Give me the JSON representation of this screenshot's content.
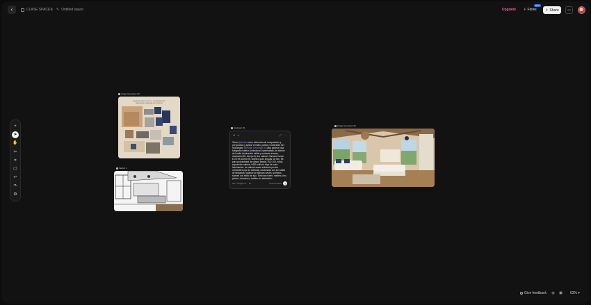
{
  "topbar": {
    "spaces_label": "CLASE SPACES",
    "separator": ">",
    "space_name": "Untitled space",
    "upgrade_label": "Upgrade",
    "flows_label": "Flows",
    "flows_badge": "New",
    "share_label": "Share"
  },
  "toolbar": {
    "tools": [
      "plus-icon",
      "cursor-icon",
      "hand-icon",
      "scissors-icon",
      "crop-icon",
      "comment-icon",
      "undo-icon",
      "redo-icon",
      "settings-icon"
    ]
  },
  "nodes": {
    "moodboard_label": "Image Generator #2",
    "moodboard_heading": "REFERENCIAS DE ESTILO Y ELABORACIÓN MATERIALES PARA SALÓN INTERIOR",
    "sketch_label": "Sketch 1",
    "assistant_label": "Assistant #1",
    "livingroom_label": "Image Generator #1"
  },
  "assistant": {
    "prompt_parts": [
      {
        "text": "Toma ",
        "mention": false
      },
      {
        "text": "@sketch",
        "mention": true
      },
      {
        "text": " como referencia de composición y perspectiva y aplicar el estilo, paleta y materiales del moodboard ",
        "mention": false
      },
      {
        "text": "@Image Generator #2",
        "mention": true
      },
      {
        "text": " para generar una fotografía interior profesional, hiperrealista, de interior de bonita iluminación cálida y sombras suaves, resolución 8K, tiempo de luz natural. Cámara Canon EOS R5 16mm f/8, objetivo gran angular 16 mm, f/8 para profundidad de campo amplia. ISO 100, nítido, exposición natural, HDR sutil sin clips de color. Iluminación: luz natural suave entrando por los ventanales (luz de mañana) combinada con luz cálida de lámparas; balance de blancos neutro; sombras suaves con estilo de lujo. Texturas reales: madera, lino, piedra, cerámica y textiles sin artefactos...",
        "mention": false
      }
    ],
    "model_label": "GPT Image",
    "aspect_label": "1:1",
    "control_label": "Control ratios"
  },
  "bottombar": {
    "feedback_label": "Give feedback",
    "zoom_label": "63%"
  }
}
